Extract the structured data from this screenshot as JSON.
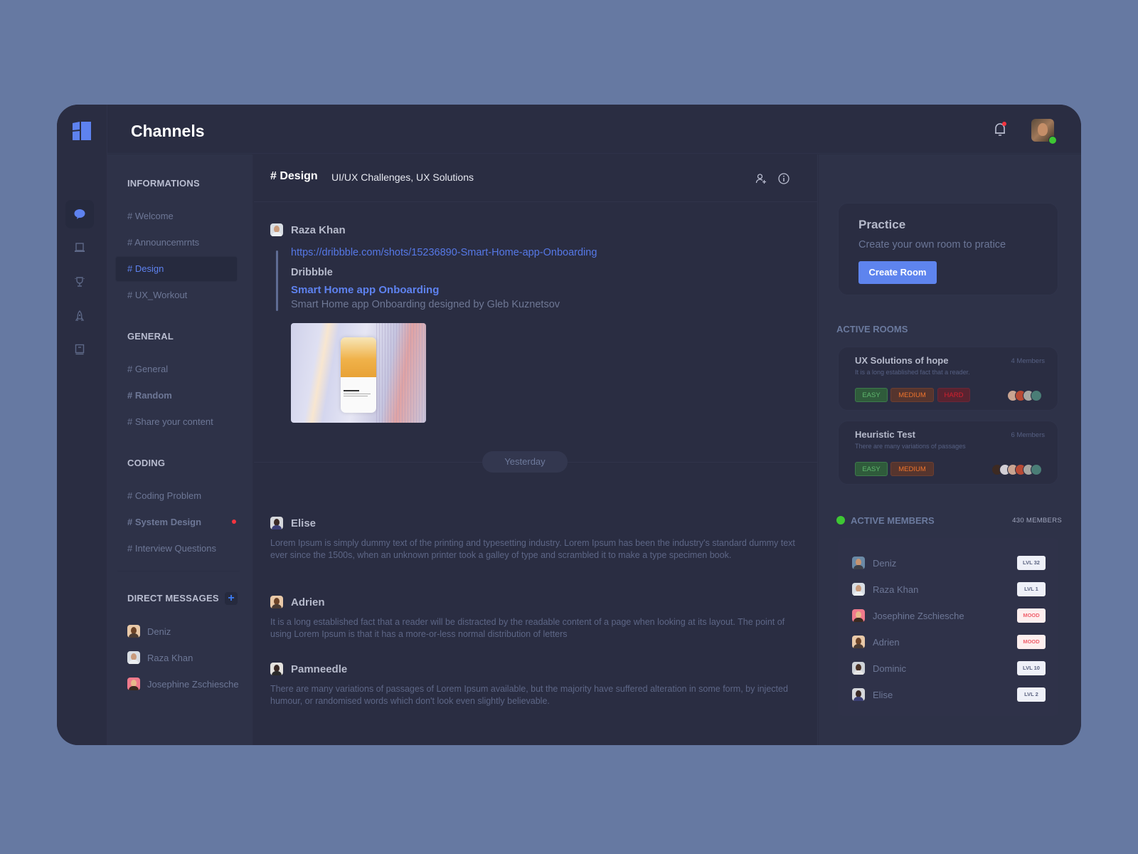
{
  "app": {
    "title": "Channels",
    "colors": {
      "accent": "#5e84ee",
      "online": "#3ec734",
      "unread": "#f5343f",
      "background": "#2a2d42"
    }
  },
  "rail": {
    "items": [
      {
        "name": "chat",
        "icon": "chat-bubble-icon",
        "active": true
      },
      {
        "name": "laptop",
        "icon": "laptop-icon",
        "active": false
      },
      {
        "name": "trophy",
        "icon": "trophy-icon",
        "active": false
      },
      {
        "name": "rocket",
        "icon": "rocket-icon",
        "active": false
      },
      {
        "name": "book",
        "icon": "book-icon",
        "active": false
      }
    ]
  },
  "topbar": {
    "notifications_icon": "bell-icon",
    "has_unread_notifications": true,
    "user_status": "online"
  },
  "channels": {
    "sections": [
      {
        "title": "INFORMATIONS",
        "items": [
          {
            "label": "# Welcome"
          },
          {
            "label": "# Announcemrnts"
          },
          {
            "label": "# Design",
            "active": true
          },
          {
            "label": "# UX_Workout"
          }
        ]
      },
      {
        "title": "GENERAL",
        "items": [
          {
            "label": "# General"
          },
          {
            "label": "# Random",
            "bold": true
          },
          {
            "label": "# Share your content"
          }
        ]
      },
      {
        "title": "CODING",
        "items": [
          {
            "label": "# Coding Problem"
          },
          {
            "label": "# System Design",
            "bold": true,
            "unread": true
          },
          {
            "label": "# Interview Questions"
          }
        ]
      }
    ],
    "direct_messages": {
      "title": "DIRECT MESSAGES",
      "add_label": "+",
      "items": [
        {
          "name": "Deniz"
        },
        {
          "name": "Raza Khan"
        },
        {
          "name": "Josephine Zschiesche"
        }
      ]
    }
  },
  "main": {
    "channel_name": "# Design",
    "channel_topic": "UI/UX Challenges, UX Solutions",
    "header_icons": [
      "add-user-icon",
      "info-icon"
    ],
    "messages": [
      {
        "author": "Raza Khan",
        "link": "https://dribbble.com/shots/15236890-Smart-Home-app-Onboarding",
        "embed": {
          "site": "Dribbble",
          "title": "Smart Home app Onboarding",
          "description": "Smart Home app Onboarding designed by Gleb Kuznetsov"
        }
      },
      {
        "author": "Elise",
        "text": "Lorem Ipsum is simply dummy text of the printing and typesetting industry. Lorem Ipsum has been the industry's standard dummy text ever since the 1500s, when an unknown printer took a galley of type and  scrambled it to make a type specimen book."
      },
      {
        "author": "Adrien",
        "text": "It is a long established fact that a reader will be distracted by the readable content of a page when looking at its layout. The point of using Lorem Ipsum is that it has a more-or-less normal distribution of letters"
      },
      {
        "author": "Pamneedle",
        "text": "There are many variations of passages of Lorem Ipsum available, but the majority have suffered alteration in some form, by injected humour, or randomised words which don't look even slightly believable."
      }
    ],
    "date_separator": "Yesterday"
  },
  "right": {
    "practice": {
      "title": "Practice",
      "subtitle": "Create your own room to pratice",
      "button": "Create Room"
    },
    "active_rooms_title": "ACTIVE ROOMS",
    "rooms": [
      {
        "title": "UX Solutions of hope",
        "description": "It is a long established fact that a reader.",
        "members": "4 Members",
        "tags": [
          "EASY",
          "MEDIUM",
          "HARD"
        ]
      },
      {
        "title": "Heuristic Test",
        "description": "There are many variations of passages",
        "members": "6 Members",
        "tags": [
          "EASY",
          "MEDIUM"
        ]
      }
    ],
    "active_members_title": "ACTIVE  MEMBERS",
    "active_members_count": "430  MEMBERS",
    "members": [
      {
        "name": "Deniz",
        "badge": "LVL 32"
      },
      {
        "name": "Raza Khan",
        "badge": "LVL 1"
      },
      {
        "name": "Josephine Zschiesche",
        "badge": "MOOD"
      },
      {
        "name": "Adrien",
        "badge": "MOOD"
      },
      {
        "name": "Dominic",
        "badge": "LVL 10"
      },
      {
        "name": "Elise",
        "badge": "LVL 2"
      }
    ]
  }
}
